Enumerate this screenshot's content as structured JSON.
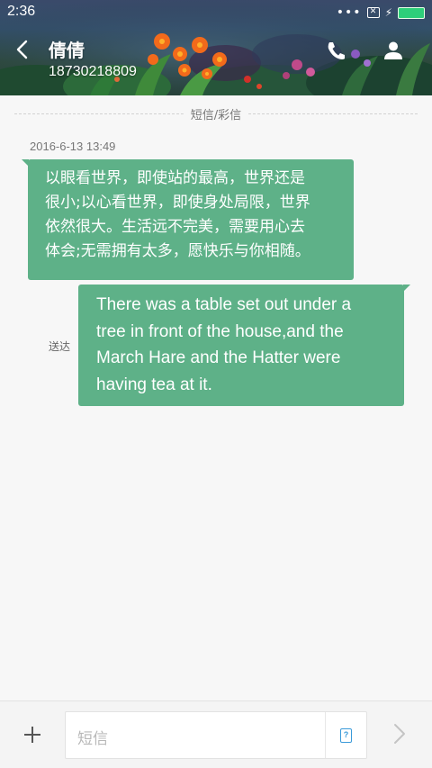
{
  "status_bar": {
    "time": "2:36",
    "more_dots": "•••",
    "sim_indicator": "✕",
    "charging_glyph": "⚡",
    "battery_color": "#2ecf7a"
  },
  "header": {
    "contact_name": "倩倩",
    "phone_number": "18730218809",
    "icons": [
      "back-icon",
      "phone-icon",
      "person-icon"
    ]
  },
  "conversation": {
    "divider_label": "短信/彩信",
    "timestamp": "2016-6-13 13:49",
    "messages": [
      {
        "direction": "incoming",
        "lines": [
          "以眼看世界，即使站的最高，世界还是",
          "很小;以心看世界，即使身处局限，世界",
          "依然很大。生活远不完美，需要用心去",
          "体会;无需拥有太多，愿快乐与你相随。"
        ]
      },
      {
        "direction": "outgoing",
        "status": "送达",
        "lines": [
          "There was a table set out under a",
          "tree in front of the house,and the",
          "March Hare and the Hatter were",
          "having tea at it."
        ]
      }
    ],
    "bubble_color": "#5eb188"
  },
  "compose": {
    "placeholder": "短信",
    "sim_badge": "?",
    "icons": [
      "plus-icon",
      "sim-icon",
      "send-icon"
    ]
  }
}
